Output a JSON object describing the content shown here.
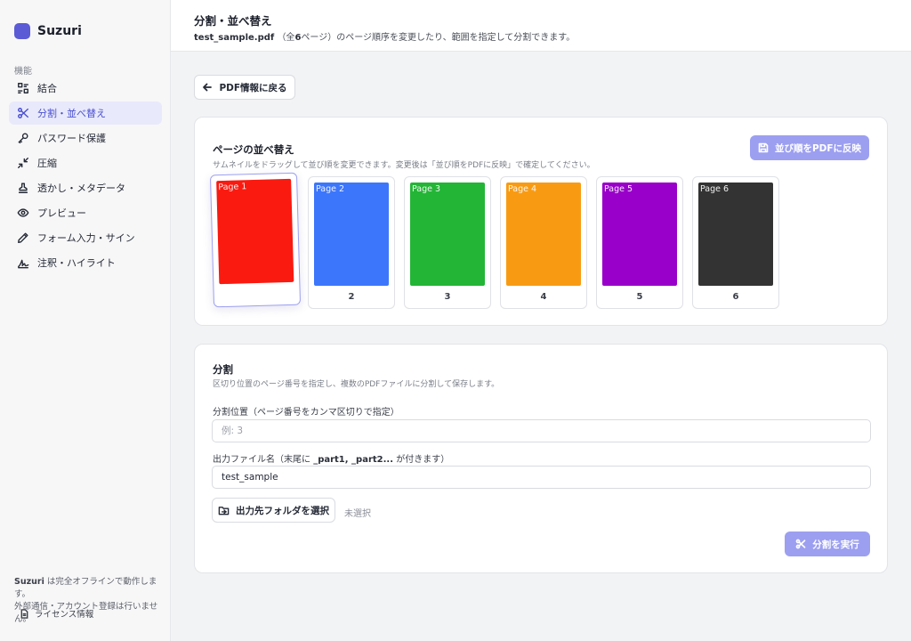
{
  "app": {
    "name": "Suzuri",
    "accent": "#5b5bd6",
    "button_disabled_color": "#9c9ff0"
  },
  "sidebar": {
    "section_label": "機能",
    "items": [
      {
        "label": "結合",
        "icon": "merge-icon",
        "active": false
      },
      {
        "label": "分割・並べ替え",
        "icon": "scissors-icon",
        "active": true
      },
      {
        "label": "パスワード保護",
        "icon": "key-icon",
        "active": false
      },
      {
        "label": "圧縮",
        "icon": "compress-icon",
        "active": false
      },
      {
        "label": "透かし・メタデータ",
        "icon": "stamp-icon",
        "active": false
      },
      {
        "label": "プレビュー",
        "icon": "eye-icon",
        "active": false
      },
      {
        "label": "フォーム入力・サイン",
        "icon": "pen-icon",
        "active": false
      },
      {
        "label": "注釈・ハイライト",
        "icon": "signature-icon",
        "active": false
      }
    ],
    "note_brand": "Suzuri",
    "note_line1": " は完全オフラインで動作します。",
    "note_line2": "外部通信・アカウント登録は行いません。",
    "license_label": "ライセンス情報"
  },
  "header": {
    "title": "分割・並べ替え",
    "file_name": "test_sample.pdf",
    "sub_pre": "（全",
    "page_count": "6",
    "sub_post": "ページ）のページ順序を変更したり、範囲を指定して分割できます。"
  },
  "back_button": {
    "label": "PDF情報に戻る"
  },
  "reorder": {
    "title": "ページの並べ替え",
    "description": "サムネイルをドラッグして並び順を変更できます。変更後は「並び順をPDFに反映」で確定してください。",
    "apply_label": "並び順をPDFに反映",
    "pages": [
      {
        "label": "Page 1",
        "number": "",
        "color": "#fa1a10"
      },
      {
        "label": "Page 2",
        "number": "2",
        "color": "#3c76fb"
      },
      {
        "label": "Page 3",
        "number": "3",
        "color": "#23b536"
      },
      {
        "label": "Page 4",
        "number": "4",
        "color": "#f89b13"
      },
      {
        "label": "Page 5",
        "number": "5",
        "color": "#9900c9"
      },
      {
        "label": "Page 6",
        "number": "6",
        "color": "#333333"
      }
    ]
  },
  "split": {
    "title": "分割",
    "description": "区切り位置のページ番号を指定し、複数のPDFファイルに分割して保存します。",
    "position_label": "分割位置（ページ番号をカンマ区切りで指定）",
    "position_value": "",
    "position_placeholder": "例: 3",
    "filename_label_pre": "出力ファイル名（末尾に ",
    "filename_label_suffix": "_part1, _part2...",
    "filename_label_post": " が付きます）",
    "filename_value": "test_sample",
    "folder_button_label": "出力先フォルダを選択",
    "folder_status": "未選択",
    "execute_label": "分割を実行"
  }
}
